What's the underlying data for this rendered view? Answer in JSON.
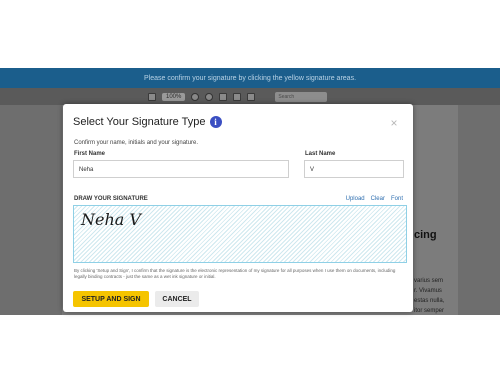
{
  "notice": {
    "text": "Please confirm your signature by clicking the yellow signature areas."
  },
  "toolbar": {
    "zoom": "100%",
    "search_placeholder": "Search"
  },
  "background": {
    "heading": "cing",
    "lines": [
      "varius sem",
      "r. Vivamus",
      "estas nulla,",
      "itor semper"
    ]
  },
  "modal": {
    "title": "Select Your Signature Type",
    "subtitle": "Confirm your name, initials and your signature.",
    "first_name_label": "First Name",
    "first_name_value": "Neha",
    "last_name_label": "Last Name",
    "last_name_value": "V",
    "draw_label": "DRAW YOUR SIGNATURE",
    "links": {
      "upload": "Upload",
      "clear": "Clear",
      "font": "Font"
    },
    "signature_text": "Neha V",
    "legal_text": "By clicking 'Setup and Sign', I confirm that the signature is the electronic representation of my signature for all purposes when I use them on documents, including legally binding contracts - just the same as a wet ink signature or initial.",
    "setup_button": "SETUP AND SIGN",
    "cancel_button": "CANCEL"
  },
  "colors": {
    "accent": "#f5c400",
    "banner": "#1b5e8c",
    "info": "#3b4fc2",
    "link": "#2f6fb0"
  }
}
